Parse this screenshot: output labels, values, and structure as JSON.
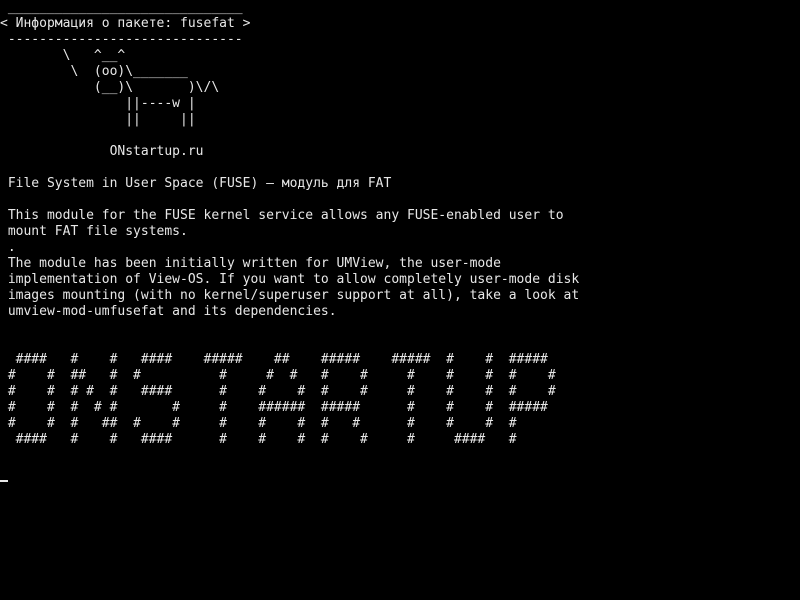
{
  "speech_bubble": {
    "top_border": " ______________________________",
    "text": "< Информация о пакете: fusefat >",
    "bottom_border": " ------------------------------"
  },
  "cow_art": [
    "        \\   ^__^",
    "         \\  (oo)\\_______",
    "            (__)\\       )\\/\\",
    "                ||----w |",
    "                ||     ||"
  ],
  "site_label": "              ONstartup.ru",
  "package_summary": " File System in User Space (FUSE) — модуль для FAT",
  "description_lines": [
    " This module for the FUSE kernel service allows any FUSE-enabled user to",
    " mount FAT file systems.",
    " .",
    " The module has been initially written for UMView, the user-mode",
    " implementation of View-OS. If you want to allow completely user-mode disk",
    " images mounting (with no kernel/superuser support at all), take a look at",
    " umview-mod-umfusefat and its dependencies."
  ],
  "banner_art": [
    "  ####   #    #   ####    #####    ##    #####    #####  #    #  #####",
    " #    #  ##   #  #          #     #  #   #    #     #    #    #  #    #",
    " #    #  # #  #   ####      #    #    #  #    #     #    #    #  #    #",
    " #    #  #  # #       #     #    ######  #####      #    #    #  #####",
    " #    #  #   ##  #    #     #    #    #  #   #      #    #    #  #",
    "  ####   #    #   ####      #    #    #  #    #     #     ####   #"
  ]
}
